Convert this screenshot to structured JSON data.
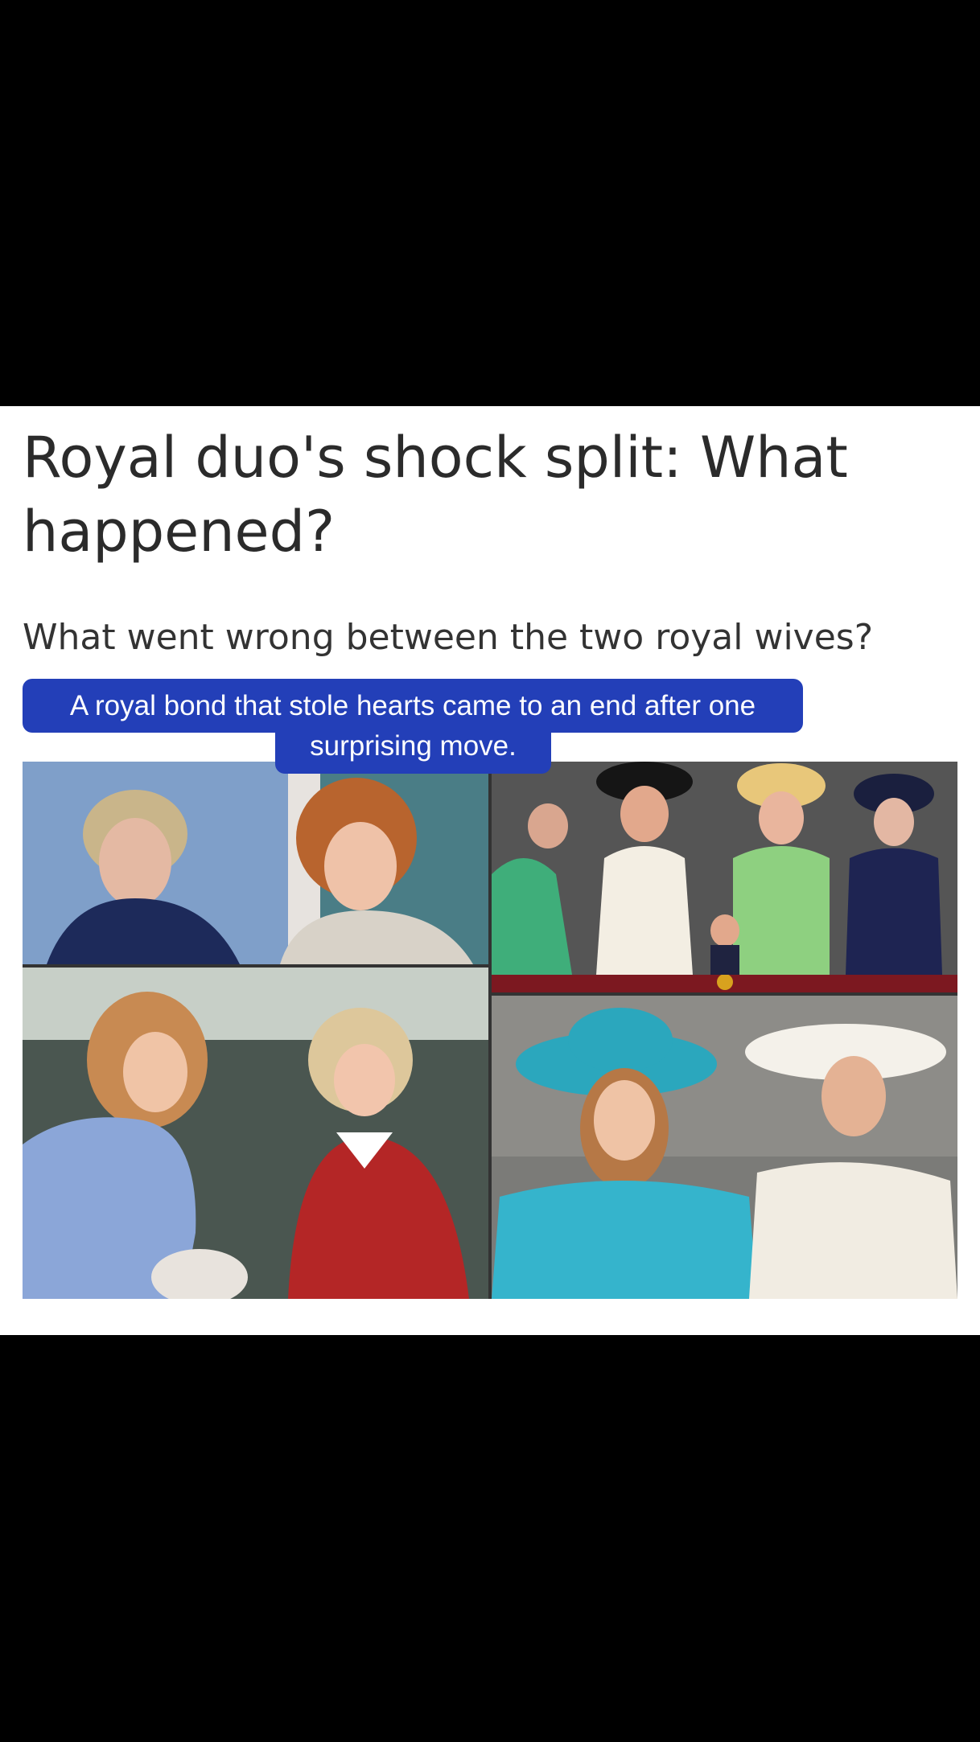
{
  "article": {
    "headline": "Royal duo's shock split: What happened?",
    "subheadline": "What went wrong between the two royal wives?",
    "caption_line1": "A royal bond that stole hearts came to an end after one",
    "caption_line2": "surprising move."
  },
  "collage": {
    "photos": [
      {
        "name": "photo-two-women-outdoors-top-left"
      },
      {
        "name": "photo-royal-balcony-hats-top-right"
      },
      {
        "name": "photo-two-women-chatting-bottom-left"
      },
      {
        "name": "photo-women-in-hats-bottom-right"
      }
    ]
  },
  "colors": {
    "caption_background": "#233fb8",
    "headline_text": "#2b2b2b",
    "page_frame": "#000000"
  }
}
